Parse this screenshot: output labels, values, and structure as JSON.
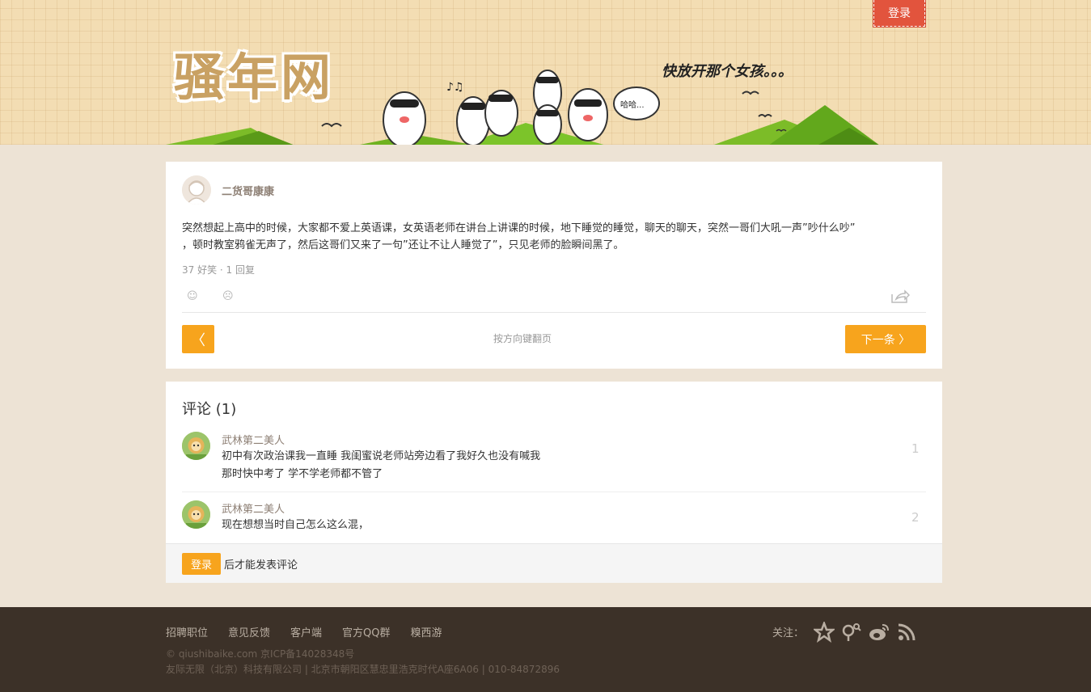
{
  "header": {
    "login_label": "登录",
    "logo_text": "骚年网",
    "slogan": "快放开那个女孩。。。",
    "bubble_text": "哈哈..."
  },
  "post": {
    "username": "二货哥康康",
    "content_line1": "突然想起上高中的时候，大家都不爱上英语课，女英语老师在讲台上讲课的时候，地下睡觉的睡觉，聊天的聊天，突然一哥们大吼一声”吵什么吵”",
    "content_line2": "，顿时教室鸦雀无声了，然后这哥们又来了一句”还让不让人睡觉了”，只见老师的脸瞬间黑了。",
    "stats": "37 好笑 · 1 回复",
    "vote_up_icon": "☺",
    "vote_down_icon": "☹",
    "prev_icon": "〈",
    "nav_hint": "按方向键翻页",
    "next_label": "下一条 〉"
  },
  "comments": {
    "title": "评论 (1)",
    "items": [
      {
        "name": "武林第二美人",
        "text_line1": "初中有次政治课我一直睡 我闺蜜说老师站旁边看了我好久也没有喊我",
        "text_line2": "那时快中考了 学不学老师都不管了",
        "floor": "1"
      },
      {
        "name": "武林第二美人",
        "text_line1": "现在想想当时自己怎么这么混，",
        "text_line2": "",
        "floor": "2"
      }
    ],
    "login_button": "登录",
    "login_hint": "后才能发表评论"
  },
  "footer": {
    "links": [
      "招聘职位",
      "意见反馈",
      "客户端",
      "官方QQ群",
      "糗西游"
    ],
    "copyright": "© qiushibaike.com 京ICP备14028348号",
    "company": "友际无限（北京）科技有限公司 | 北京市朝阳区慧忠里浩克时代A座6A06 | 010-84872896",
    "follow_label": "关注："
  },
  "colors": {
    "accent": "#f7a41d",
    "login_red": "#e2543d",
    "footer_bg": "#3c3128",
    "page_bg": "#ede3d5"
  }
}
